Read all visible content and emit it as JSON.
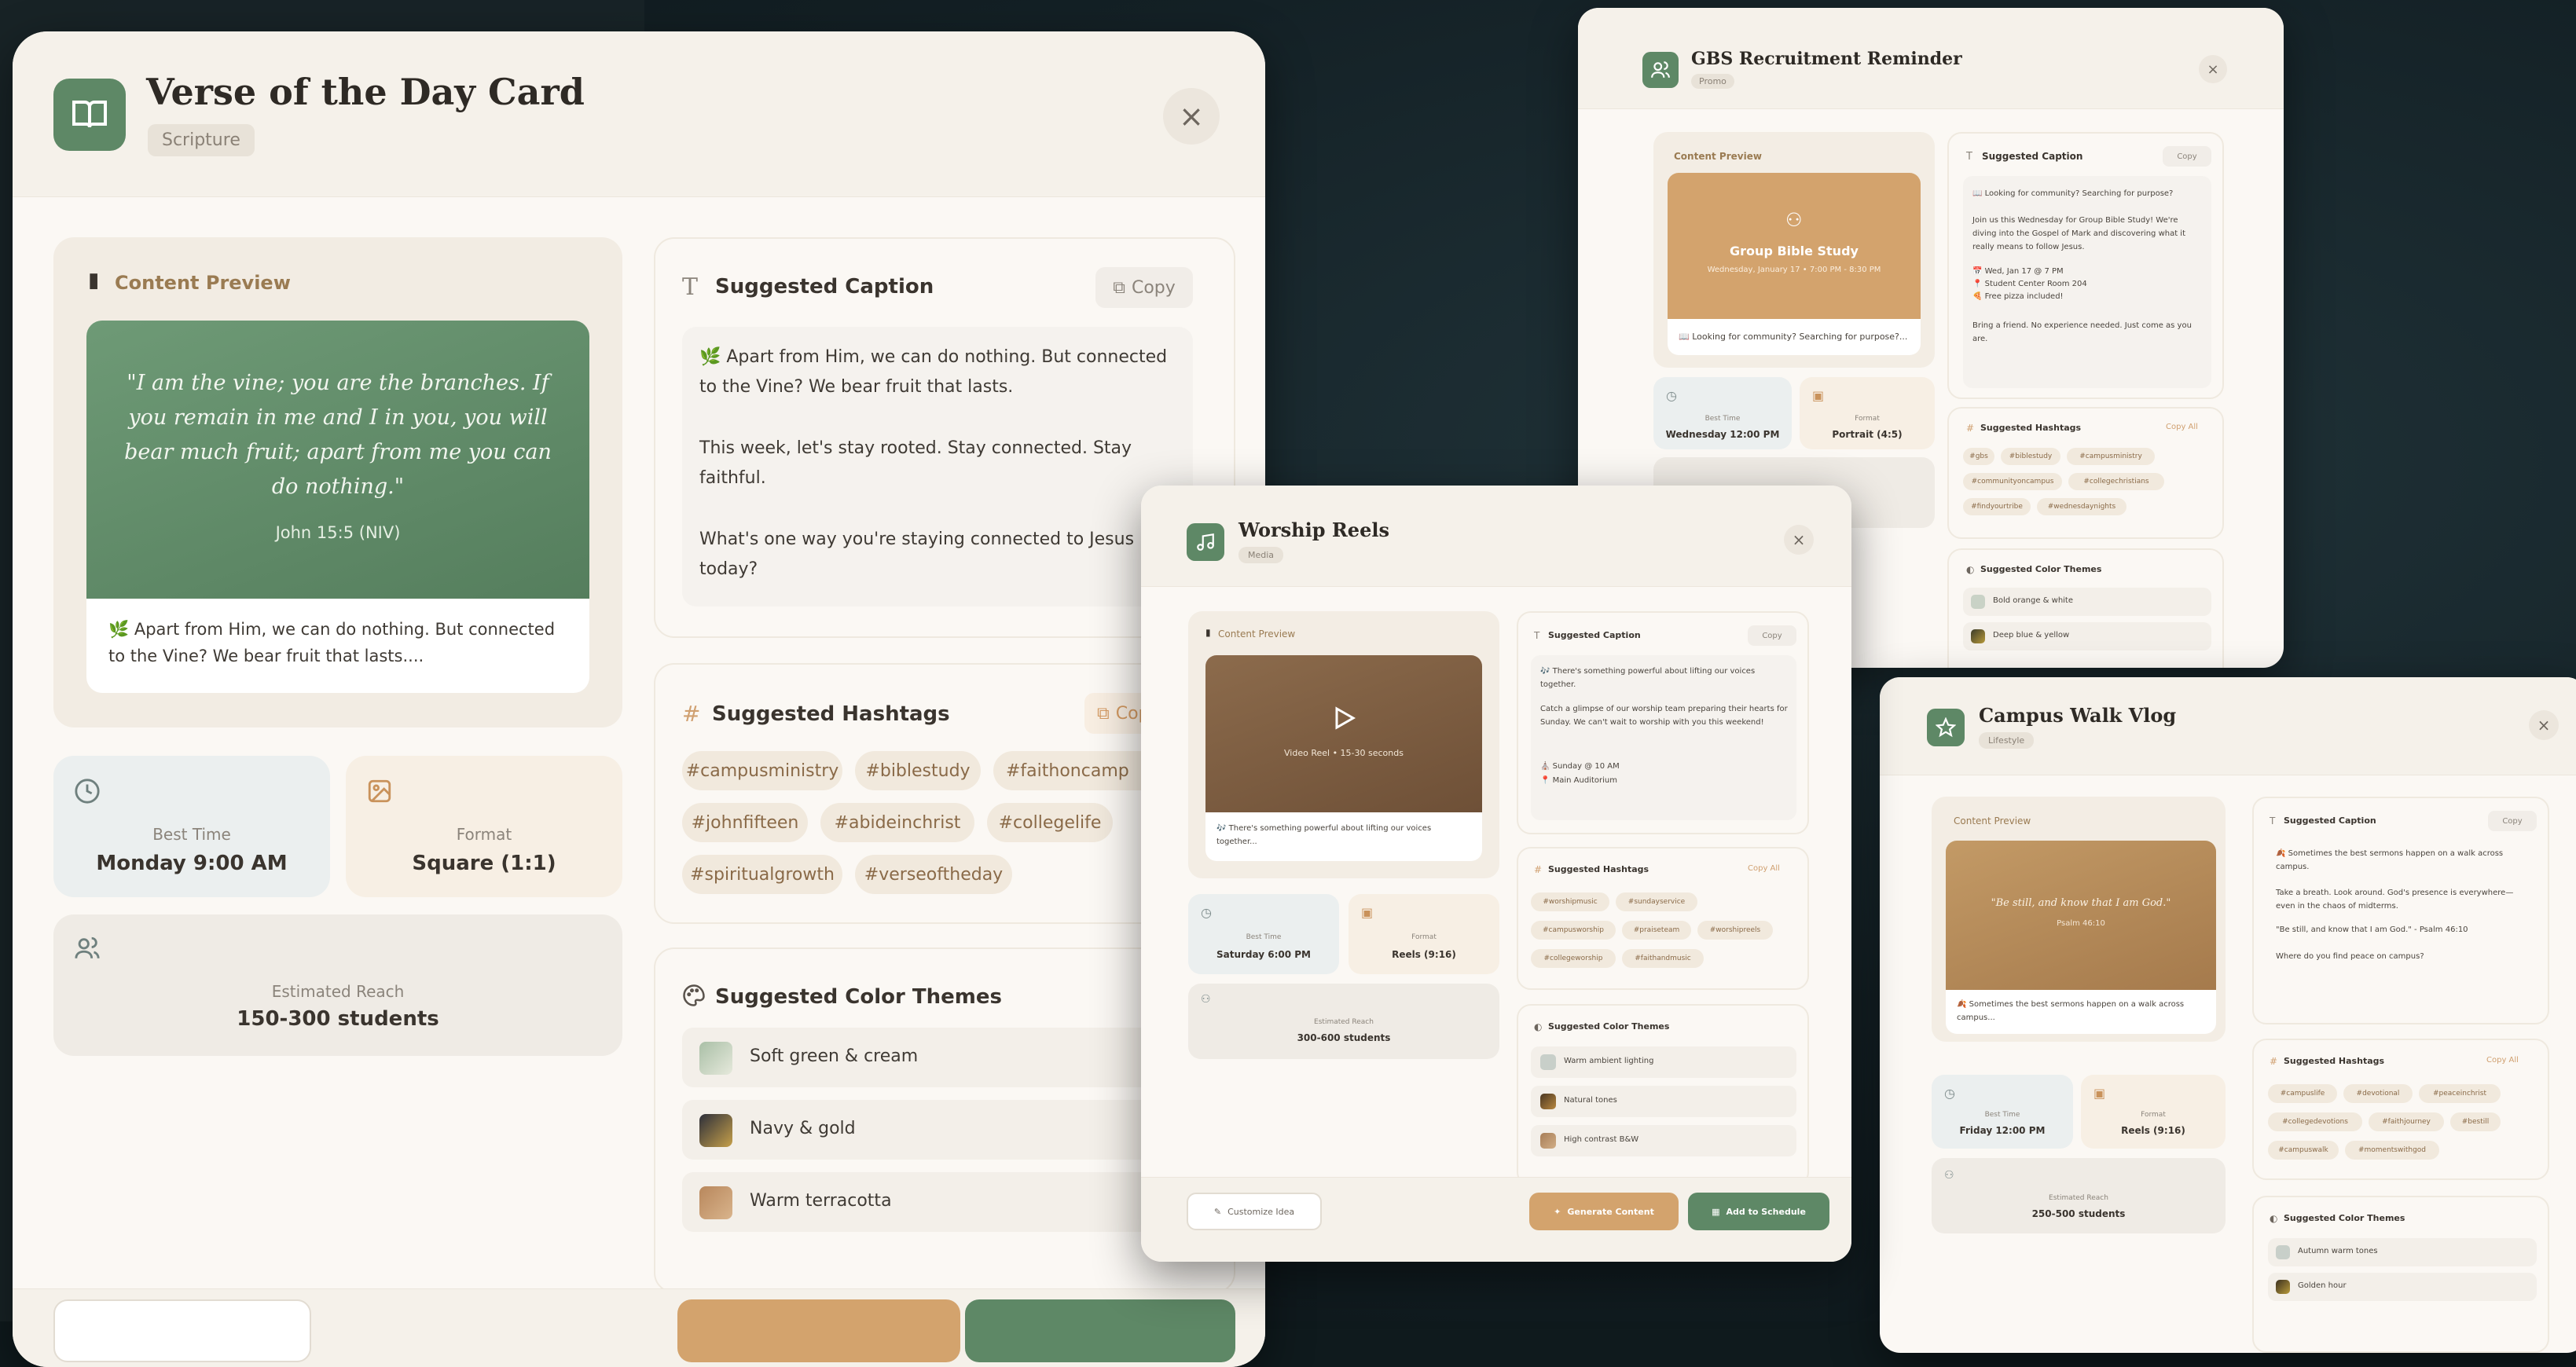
{
  "v": {
    "title": "Verse of the Day Card",
    "tag": "Scripture",
    "preview_title": "Content Preview",
    "quote": "\"I am the vine; you are the branches. If you remain in me and I in you, you will bear much fruit; apart from me you can do nothing.\"",
    "ref": "John 15:5 (NIV)",
    "preview_caption": "🌿 Apart from Him, we can do nothing. But connected to the Vine? We bear fruit that lasts....",
    "best_time_label": "Best Time",
    "best_time": "Monday 9:00 AM",
    "format_label": "Format",
    "format": "Square (1:1)",
    "reach_label": "Estimated Reach",
    "reach": "150-300 students",
    "caption_title": "Suggested Caption",
    "copy": "Copy",
    "caption_p1": "🌿 Apart from Him, we can do nothing. But connected to the Vine? We bear fruit that lasts.",
    "caption_p2": "This week, let's stay rooted. Stay connected. Stay faithful.",
    "caption_p3": "What's one way you're staying connected to Jesus today?",
    "hashtags_title": "Suggested Hashtags",
    "copy_all": "Cop",
    "hashtags": [
      "#campusministry",
      "#biblestudy",
      "#faithoncamp",
      "#johnfifteen",
      "#abideinchrist",
      "#collegelife",
      "#spiritualgrowth",
      "#verseoftheday"
    ],
    "colors_title": "Suggested Color Themes",
    "themes": [
      "Soft green & cream",
      "Navy & gold",
      "Warm terracotta"
    ]
  },
  "g": {
    "title": "GBS Recruitment Reminder",
    "tag": "Promo",
    "preview_title": "Content Preview",
    "card_title": "Group Bible Study",
    "card_sub": "Wednesday, January 17 • 7:00 PM - 8:30 PM",
    "preview_caption": "📖 Looking for community? Searching for purpose?...",
    "best_time_label": "Best Time",
    "best_time": "Wednesday 12:00 PM",
    "format_label": "Format",
    "format": "Portrait (4:5)",
    "caption_title": "Suggested Caption",
    "copy": "Copy",
    "caption_p1": "📖 Looking for community? Searching for purpose?",
    "caption_p2": "Join us this Wednesday for Group Bible Study! We're diving into the Gospel of Mark and discovering what it really means to follow Jesus.",
    "caption_p3a": "📅 Wed, Jan 17 @ 7 PM",
    "caption_p3b": "📍 Student Center Room 204",
    "caption_p3c": "🍕 Free pizza included!",
    "caption_p4": "Bring a friend. No experience needed. Just come as you are.",
    "hashtags_title": "Suggested Hashtags",
    "copy_all": "Copy All",
    "hashtags": [
      "#gbs",
      "#biblestudy",
      "#campusministry",
      "#communityoncampus",
      "#collegechristians",
      "#findyourtribe",
      "#wednesdaynights"
    ],
    "colors_title": "Suggested Color Themes",
    "themes": [
      "Bold orange & white",
      "Deep blue & yellow"
    ]
  },
  "w": {
    "title": "Worship Reels",
    "tag": "Media",
    "preview_title": "Content Preview",
    "video_label": "Video Reel • 15-30 seconds",
    "preview_caption": "🎶 There's something powerful about lifting our voices together...",
    "best_time_label": "Best Time",
    "best_time": "Saturday 6:00 PM",
    "format_label": "Format",
    "format": "Reels (9:16)",
    "reach_label": "Estimated Reach",
    "reach": "300-600 students",
    "caption_title": "Suggested Caption",
    "copy": "Copy",
    "caption_p1": "🎶 There's something powerful about lifting our voices together.",
    "caption_p2": "Catch a glimpse of our worship team preparing their hearts for Sunday. We can't wait to worship with you this weekend!",
    "caption_p3a": "⛪ Sunday @ 10 AM",
    "caption_p3b": "📍 Main Auditorium",
    "hashtags_title": "Suggested Hashtags",
    "copy_all": "Copy All",
    "hashtags": [
      "#worshipmusic",
      "#sundayservice",
      "#campusworship",
      "#praiseteam",
      "#worshipreels",
      "#collegeworship",
      "#faithandmusic"
    ],
    "colors_title": "Suggested Color Themes",
    "themes": [
      "Warm ambient lighting",
      "Natural tones",
      "High contrast B&W"
    ],
    "customize": "Customize Idea",
    "generate": "Generate Content",
    "schedule": "Add to Schedule"
  },
  "c": {
    "title": "Campus Walk Vlog",
    "tag": "Lifestyle",
    "preview_title": "Content Preview",
    "quote": "\"Be still, and know that I am God.\"",
    "ref": "Psalm 46:10",
    "preview_caption": "🍂 Sometimes the best sermons happen on a walk across campus...",
    "best_time_label": "Best Time",
    "best_time": "Friday 12:00 PM",
    "format_label": "Format",
    "format": "Reels (9:16)",
    "reach_label": "Estimated Reach",
    "reach": "250-500 students",
    "caption_title": "Suggested Caption",
    "copy": "Copy",
    "caption_p1": "🍂 Sometimes the best sermons happen on a walk across campus.",
    "caption_p2": "Take a breath. Look around. God's presence is everywhere—even in the chaos of midterms.",
    "caption_p3": "\"Be still, and know that I am God.\" - Psalm 46:10",
    "caption_p4": "Where do you find peace on campus?",
    "hashtags_title": "Suggested Hashtags",
    "copy_all": "Copy All",
    "hashtags": [
      "#campuslife",
      "#devotional",
      "#peaceinchrist",
      "#collegedevotions",
      "#faithjourney",
      "#bestill",
      "#campuswalk",
      "#momentswithgod"
    ],
    "colors_title": "Suggested Color Themes",
    "themes": [
      "Autumn warm tones",
      "Golden hour"
    ]
  }
}
